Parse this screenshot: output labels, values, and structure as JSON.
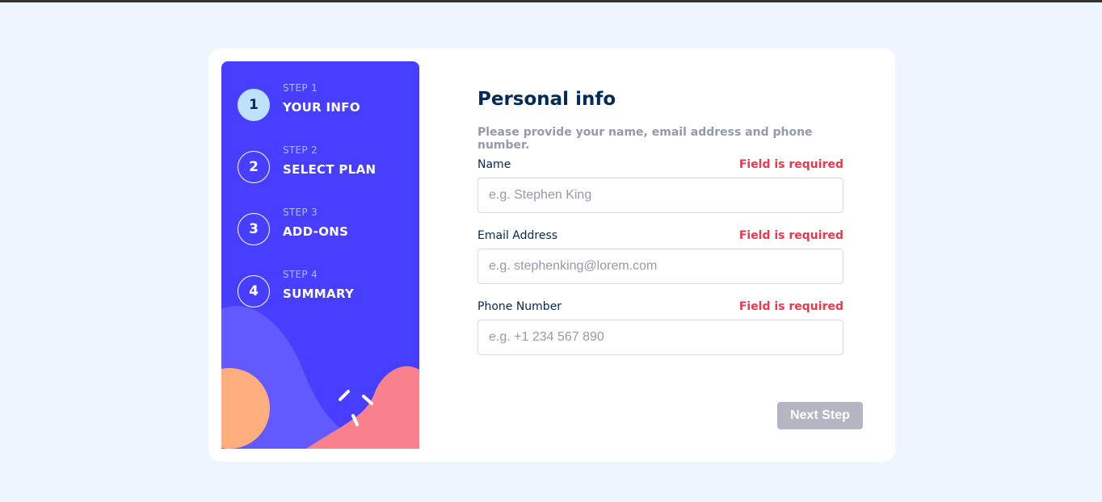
{
  "steps": [
    {
      "number": "1",
      "kicker": "STEP 1",
      "title": "YOUR INFO",
      "active": true
    },
    {
      "number": "2",
      "kicker": "STEP 2",
      "title": "SELECT PLAN",
      "active": false
    },
    {
      "number": "3",
      "kicker": "STEP 3",
      "title": "ADD-ONS",
      "active": false
    },
    {
      "number": "4",
      "kicker": "STEP 4",
      "title": "SUMMARY",
      "active": false
    }
  ],
  "form": {
    "heading": "Personal info",
    "subtitle": "Please provide your name, email address and phone number.",
    "fields": [
      {
        "label": "Name",
        "error": "Field is required",
        "placeholder": "e.g. Stephen King",
        "value": ""
      },
      {
        "label": "Email Address",
        "error": "Field is required",
        "placeholder": "e.g. stephenking@lorem.com",
        "value": ""
      },
      {
        "label": "Phone Number",
        "error": "Field is required",
        "placeholder": "e.g. +1 234 567 890",
        "value": ""
      }
    ],
    "next_label": "Next Step"
  },
  "colors": {
    "page_bg": "#eef5ff",
    "sidebar": "#483eff",
    "active_step": "#bee2fd",
    "heading": "#022959",
    "error": "#ee374a",
    "button_disabled": "#b4b6c4"
  }
}
